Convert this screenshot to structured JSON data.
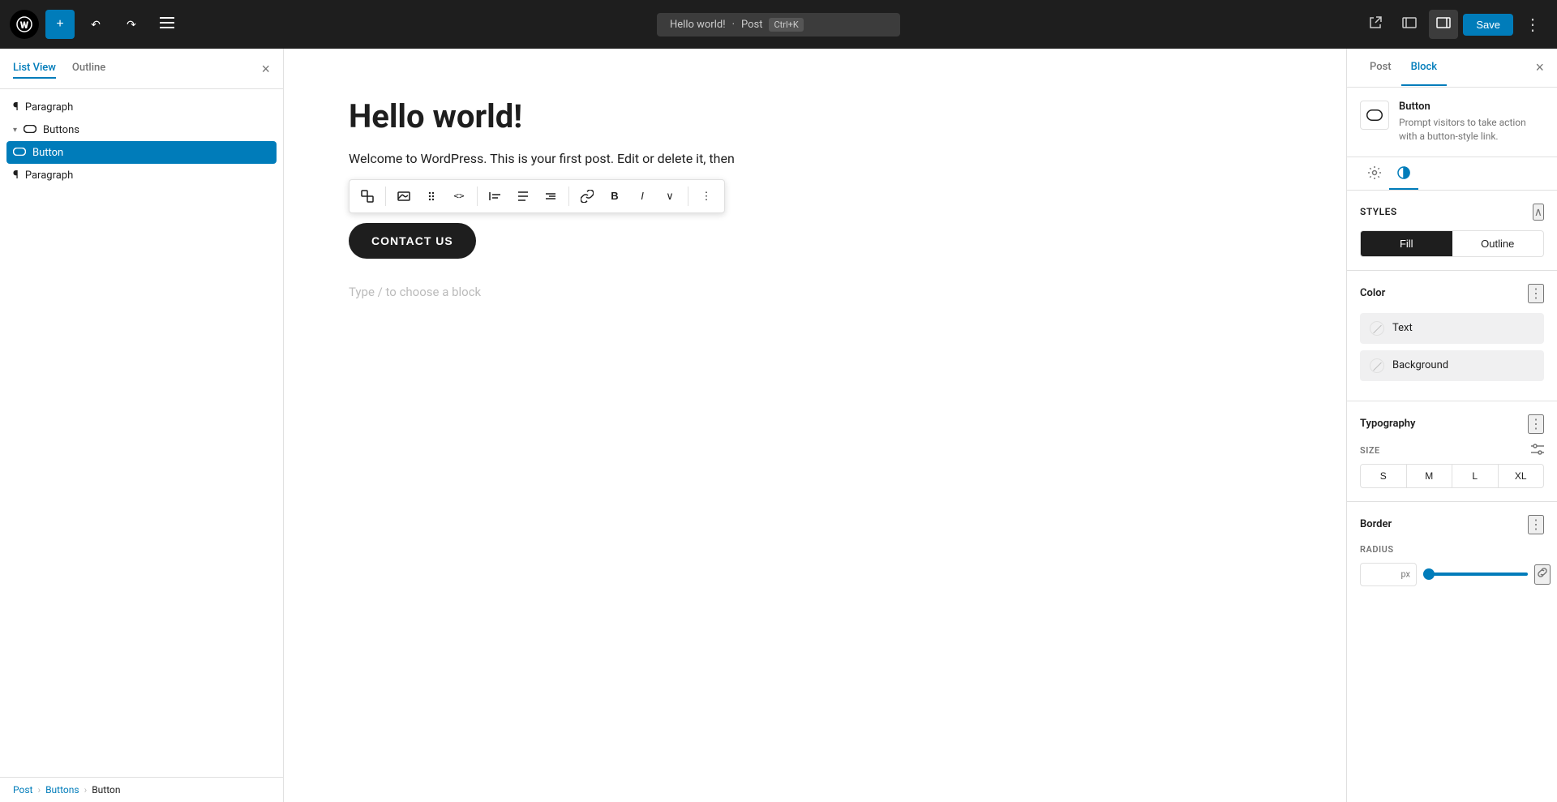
{
  "topbar": {
    "wp_logo": "W",
    "add_label": "+",
    "undo_label": "↩",
    "redo_label": "↪",
    "menu_label": "≡",
    "title": "Hello world!",
    "separator": "·",
    "post_label": "Post",
    "shortcut": "Ctrl+K",
    "external_icon": "⬡",
    "view_icon": "□",
    "settings_icon": "⊡",
    "save_label": "Save",
    "more_icon": "⋮"
  },
  "left_panel": {
    "tab_list": "List View",
    "tab_outline": "Outline",
    "close_icon": "×",
    "items": [
      {
        "label": "Paragraph",
        "icon": "¶",
        "indent": false,
        "has_chevron": false
      },
      {
        "label": "Buttons",
        "icon": "⊡",
        "indent": false,
        "has_chevron": true,
        "chevron": "▾"
      },
      {
        "label": "Button",
        "icon": "⊡",
        "indent": true,
        "selected": true
      },
      {
        "label": "Paragraph",
        "icon": "¶",
        "indent": false,
        "has_chevron": false
      }
    ],
    "breadcrumb": {
      "post": "Post",
      "sep1": "›",
      "buttons": "Buttons",
      "sep2": "›",
      "button": "Button"
    }
  },
  "editor": {
    "title": "Hello world!",
    "paragraph": "Welcome to WordPress. This is your first post. Edit or delete it, then",
    "contact_btn": "CONTACT US",
    "placeholder": "Type / to choose a block",
    "toolbar": {
      "block_icon": "⊞",
      "inline_icon": "⊟",
      "drag_icon": "⠿",
      "code_icon": "<>",
      "align_left": "←|",
      "align_center": "+",
      "align_right": "|||",
      "link_icon": "⊕",
      "bold": "B",
      "italic": "I",
      "more": "∨",
      "options": "⋮"
    }
  },
  "right_panel": {
    "tab_post": "Post",
    "tab_block": "Block",
    "close_icon": "×",
    "block_info": {
      "icon": "⊡",
      "title": "Button",
      "description": "Prompt visitors to take action with a button-style link."
    },
    "settings_tab_gear": "⚙",
    "settings_tab_contrast": "◑",
    "styles": {
      "title": "Styles",
      "collapse_icon": "∧",
      "fill_label": "Fill",
      "outline_label": "Outline"
    },
    "color": {
      "title": "Color",
      "more_icon": "⋮",
      "text_label": "Text",
      "background_label": "Background"
    },
    "typography": {
      "title": "Typography",
      "more_icon": "⋮",
      "size_label": "SIZE",
      "size_controls_icon": "⇄",
      "sizes": [
        "S",
        "M",
        "L",
        "XL"
      ]
    },
    "border": {
      "title": "Border",
      "more_icon": "⋮",
      "radius_label": "RADIUS",
      "radius_value": "",
      "radius_unit": "px",
      "link_icon": "⊕"
    }
  }
}
